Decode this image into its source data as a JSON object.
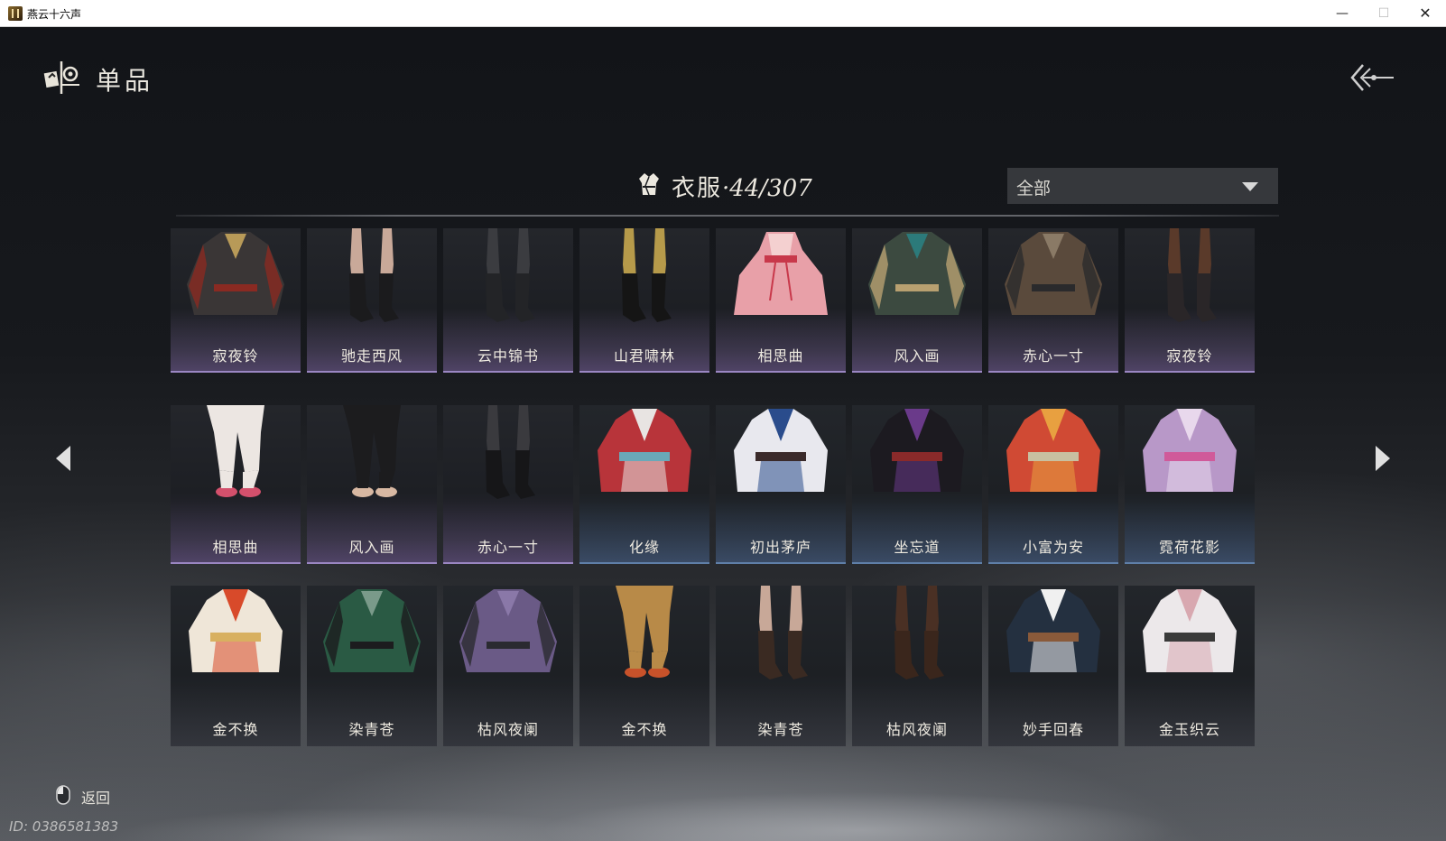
{
  "window": {
    "title": "燕云十六声",
    "min_glyph": "—",
    "max_glyph": "☐",
    "close_glyph": "✕"
  },
  "header": {
    "title": "单品",
    "icon": "item-emblem-icon",
    "back_icon": "back-arrow-icon"
  },
  "category": {
    "label": "衣服",
    "separator": "·",
    "count": "44/307",
    "icon": "robe-icon"
  },
  "filter": {
    "selected": "全部"
  },
  "items": [
    {
      "name": "寂夜铃",
      "kind": "jacket",
      "palette": [
        "#3a3636",
        "#8a2a22",
        "#b89a58"
      ],
      "rarity": "purple"
    },
    {
      "name": "驰走西风",
      "kind": "boots",
      "palette": [
        "#1b1b1d",
        "#c9a999"
      ],
      "rarity": "purple"
    },
    {
      "name": "云中锦书",
      "kind": "boots",
      "palette": [
        "#232427",
        "#3b3c40"
      ],
      "rarity": "purple"
    },
    {
      "name": "山君啸林",
      "kind": "boots",
      "palette": [
        "#151515",
        "#b69a4a"
      ],
      "rarity": "purple"
    },
    {
      "name": "相思曲",
      "kind": "dress",
      "palette": [
        "#e8a0a8",
        "#f4d0d0",
        "#c8384a"
      ],
      "rarity": "purple"
    },
    {
      "name": "风入画",
      "kind": "jacket",
      "palette": [
        "#3c4a40",
        "#b8a070",
        "#2c7a7a"
      ],
      "rarity": "purple"
    },
    {
      "name": "赤心一寸",
      "kind": "jacket",
      "palette": [
        "#5a4a3c",
        "#2a2a2c",
        "#8a7a66"
      ],
      "rarity": "purple"
    },
    {
      "name": "寂夜铃",
      "kind": "boots",
      "palette": [
        "#2a2628",
        "#5a3a2a"
      ],
      "rarity": "purple"
    },
    {
      "name": "相思曲",
      "kind": "pants",
      "palette": [
        "#ece6e2",
        "#d4506c"
      ],
      "rarity": "purple"
    },
    {
      "name": "风入画",
      "kind": "pants",
      "palette": [
        "#1c1c1e",
        "#d8b8a2"
      ],
      "rarity": "purple"
    },
    {
      "name": "赤心一寸",
      "kind": "boots",
      "palette": [
        "#161618",
        "#3a3a3e"
      ],
      "rarity": "purple"
    },
    {
      "name": "化缘",
      "kind": "robe",
      "palette": [
        "#b8343a",
        "#e8e4e2",
        "#6aa8b8"
      ],
      "rarity": "blue"
    },
    {
      "name": "初出茅庐",
      "kind": "robe",
      "palette": [
        "#e8e8ee",
        "#2a4c8c",
        "#3a2a2a"
      ],
      "rarity": "blue"
    },
    {
      "name": "坐忘道",
      "kind": "robe",
      "palette": [
        "#1c1a20",
        "#6a3a8a",
        "#8a2a2a"
      ],
      "rarity": "blue"
    },
    {
      "name": "小富为安",
      "kind": "robe",
      "palette": [
        "#d04a34",
        "#e8a040",
        "#c8c0a0"
      ],
      "rarity": "blue"
    },
    {
      "name": "霓荷花影",
      "kind": "robe",
      "palette": [
        "#b898c8",
        "#e8d8ec",
        "#d05a9a"
      ],
      "rarity": "blue"
    },
    {
      "name": "金不换",
      "kind": "robe",
      "palette": [
        "#efe6d8",
        "#d84a2a",
        "#d8b060"
      ],
      "rarity": "plain"
    },
    {
      "name": "染青苍",
      "kind": "jacket",
      "palette": [
        "#2a5a44",
        "#1c1c1e",
        "#7a9a8a"
      ],
      "rarity": "plain"
    },
    {
      "name": "枯风夜阑",
      "kind": "jacket",
      "palette": [
        "#6a5a86",
        "#2a2a30",
        "#8a78a8"
      ],
      "rarity": "plain"
    },
    {
      "name": "金不换",
      "kind": "pants",
      "palette": [
        "#b88a48",
        "#c8522a"
      ],
      "rarity": "plain"
    },
    {
      "name": "染青苍",
      "kind": "boots",
      "palette": [
        "#3a2a22",
        "#c8a898"
      ],
      "rarity": "plain"
    },
    {
      "name": "枯风夜阑",
      "kind": "boots",
      "palette": [
        "#3a261c",
        "#4a3024"
      ],
      "rarity": "plain"
    },
    {
      "name": "妙手回春",
      "kind": "robe",
      "palette": [
        "#243040",
        "#f0f0f0",
        "#8a5a3a"
      ],
      "rarity": "plain"
    },
    {
      "name": "金玉织云",
      "kind": "robe",
      "palette": [
        "#ece8ea",
        "#d8a8b0",
        "#3a3a3a"
      ],
      "rarity": "plain"
    }
  ],
  "nav": {
    "prev_icon": "page-left-arrow-icon",
    "next_icon": "page-right-arrow-icon"
  },
  "footer": {
    "back_label": "返回",
    "back_icon": "mouse-icon",
    "user_id": "ID: 0386581383"
  }
}
